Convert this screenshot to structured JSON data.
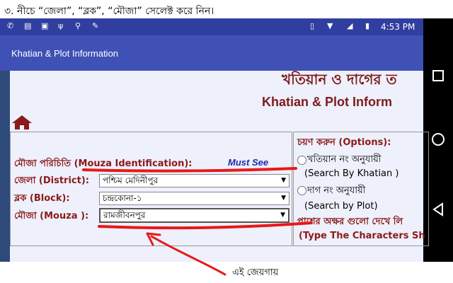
{
  "caption": "৩. নীচে “জেলা”, “ব্লক”, “মৌজা” সেলেক্ট করে নিন।",
  "statusbar": {
    "time": "4:53 PM"
  },
  "app": {
    "title": "Khatian & Plot Information"
  },
  "page": {
    "title_bn": "খতিয়ান ও দাগের ত",
    "title_en": "Khatian & Plot Inform"
  },
  "form": {
    "mouza_id_label": "মৌজা পরিচিতি (Mouza Identification):",
    "must_see": "Must See",
    "district_label": "জেলা (District):",
    "district_value": "পশ্চিম মেদিনীপুর",
    "block_label": "ব্লক (Block):",
    "block_value": "চন্দ্রকোনা-১",
    "mouza_label": "মৌজা (Mouza ):",
    "mouza_value": "রামজীবনপুর"
  },
  "options": {
    "heading": "চয়ণ করুন (Options):",
    "khatian_bn": "খতিয়ান নং অনুযায়ী",
    "khatian_en": "(Search By Khatian )",
    "plot_bn": "দাগ নং অনুযায়ী",
    "plot_en": "(Search by Plot)",
    "chars_bn": "পাশের অক্ষর গুলো দেখে লি",
    "chars_en": "(Type The Characters Sh"
  },
  "annotation": "এই জেয়গায়",
  "colors": {
    "annotation_red": "#e81818",
    "label_maroon": "#8b1a1a",
    "appbar": "#3f51b5"
  }
}
